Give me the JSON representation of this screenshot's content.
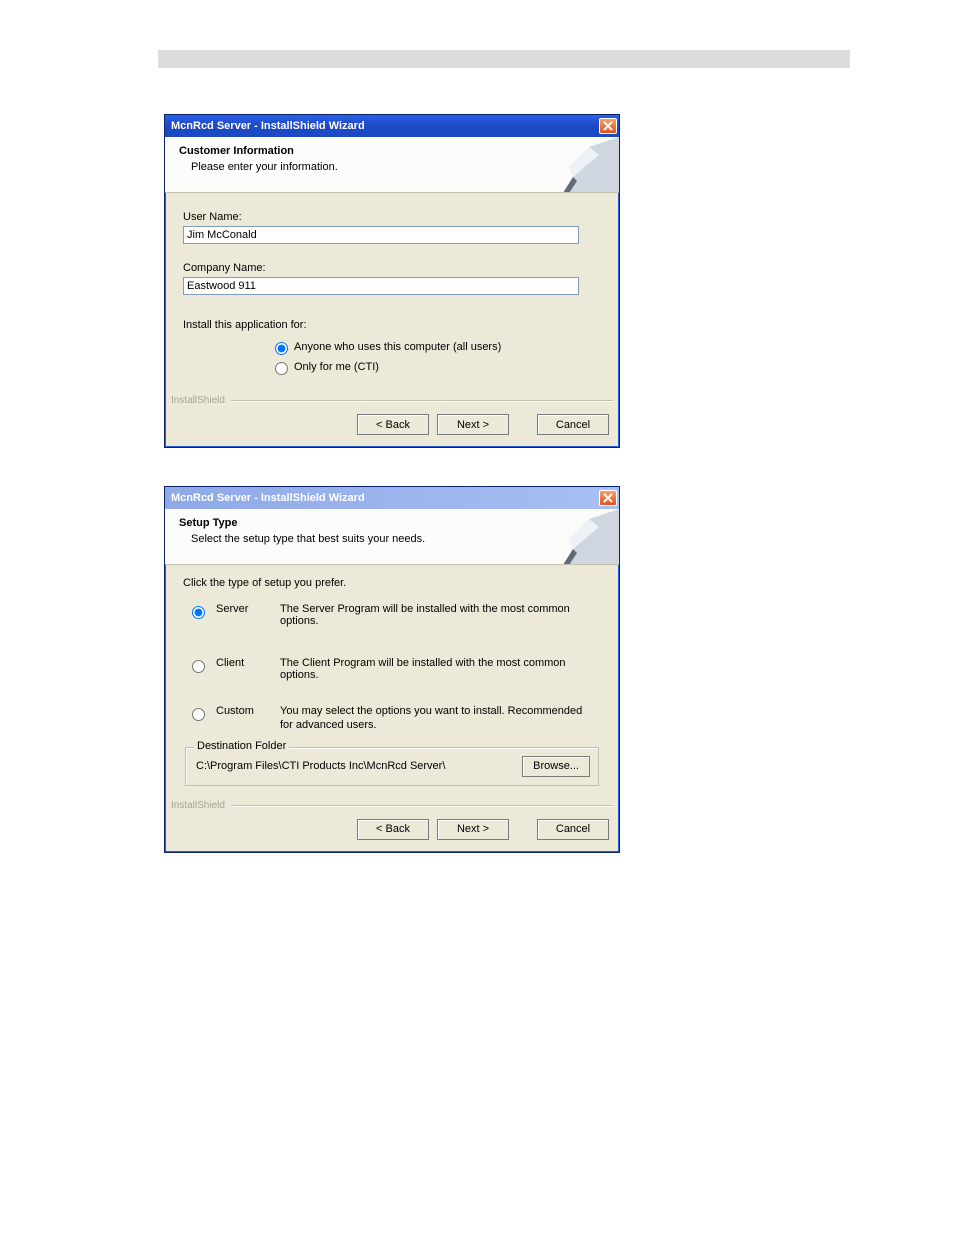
{
  "dialog1": {
    "title": "McnRcd Server - InstallShield Wizard",
    "header_title": "Customer Information",
    "header_sub": "Please enter your information.",
    "user_label": "User Name:",
    "user_value": "Jim McConald",
    "company_label": "Company Name:",
    "company_value": "Eastwood 911",
    "install_for_label": "Install this application for:",
    "radio_all": "Anyone who uses this computer (all users)",
    "radio_me": "Only for me (CTI)",
    "brand": "InstallShield",
    "back": "< Back",
    "next": "Next >",
    "cancel": "Cancel"
  },
  "dialog2": {
    "title": "McnRcd Server - InstallShield Wizard",
    "header_title": "Setup Type",
    "header_sub": "Select the setup type that best suits your needs.",
    "intro": "Click the type of setup you prefer.",
    "server_label": "Server",
    "server_desc": "The Server Program will be installed with the most common options.",
    "client_label": "Client",
    "client_desc": "The Client Program will be installed with the most common options.",
    "custom_label": "Custom",
    "custom_desc": "You may select the options you want to install. Recommended for advanced users.",
    "dest_legend": "Destination Folder",
    "dest_path": "C:\\Program Files\\CTI Products Inc\\McnRcd Server\\",
    "browse": "Browse...",
    "brand": "InstallShield",
    "back": "< Back",
    "next": "Next >",
    "cancel": "Cancel"
  }
}
